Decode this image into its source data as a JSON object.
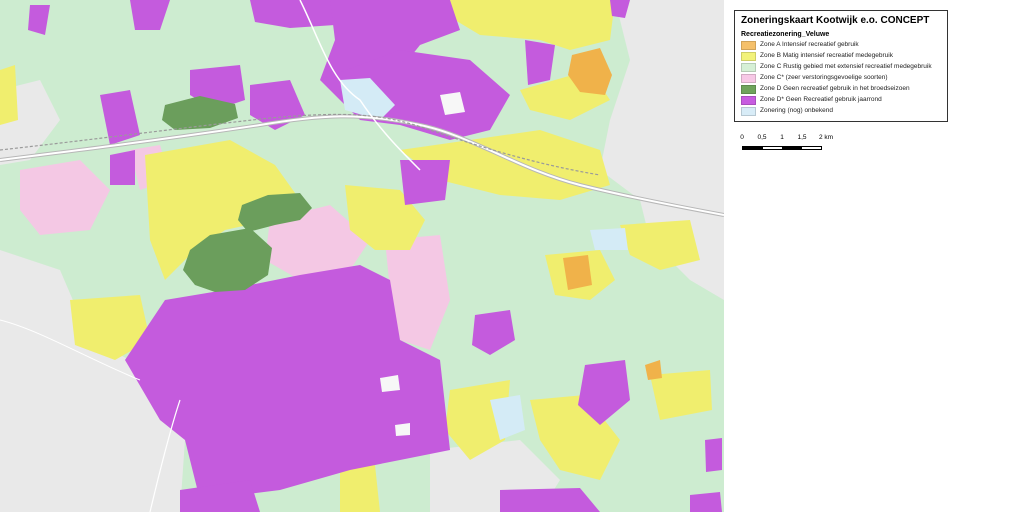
{
  "legend": {
    "title": "Zoneringskaart Kootwijk e.o. CONCEPT",
    "subtitle": "Recreatiezonering_Veluwe",
    "items": [
      {
        "label": "Zone A Intensief recreatief gebruik",
        "color": "#f5c06a"
      },
      {
        "label": "Zone B Matig intensief recreatief medegebruik",
        "color": "#f2f27a"
      },
      {
        "label": "Zone C Rustig gebied met extensief recreatief medegebruik",
        "color": "#d6f0d6"
      },
      {
        "label": "Zone C* (zeer verstoringsgevoelige soorten)",
        "color": "#f7c9e6"
      },
      {
        "label": "Zone D Geen recreatief gebruik in het broedseizoen",
        "color": "#6fa35c"
      },
      {
        "label": "Zone D* Geen Recreatief gebruik jaarrond",
        "color": "#c75ce0"
      },
      {
        "label": "Zonering (nog) onbekend",
        "color": "#d8ecf7"
      }
    ]
  },
  "scale": {
    "labels": [
      "0",
      "0,5",
      "1",
      "1,5",
      "2 km"
    ]
  },
  "map": {
    "background_color": "#cdecd0",
    "urban_color": "#ececec",
    "road_color": "#ffffff"
  }
}
